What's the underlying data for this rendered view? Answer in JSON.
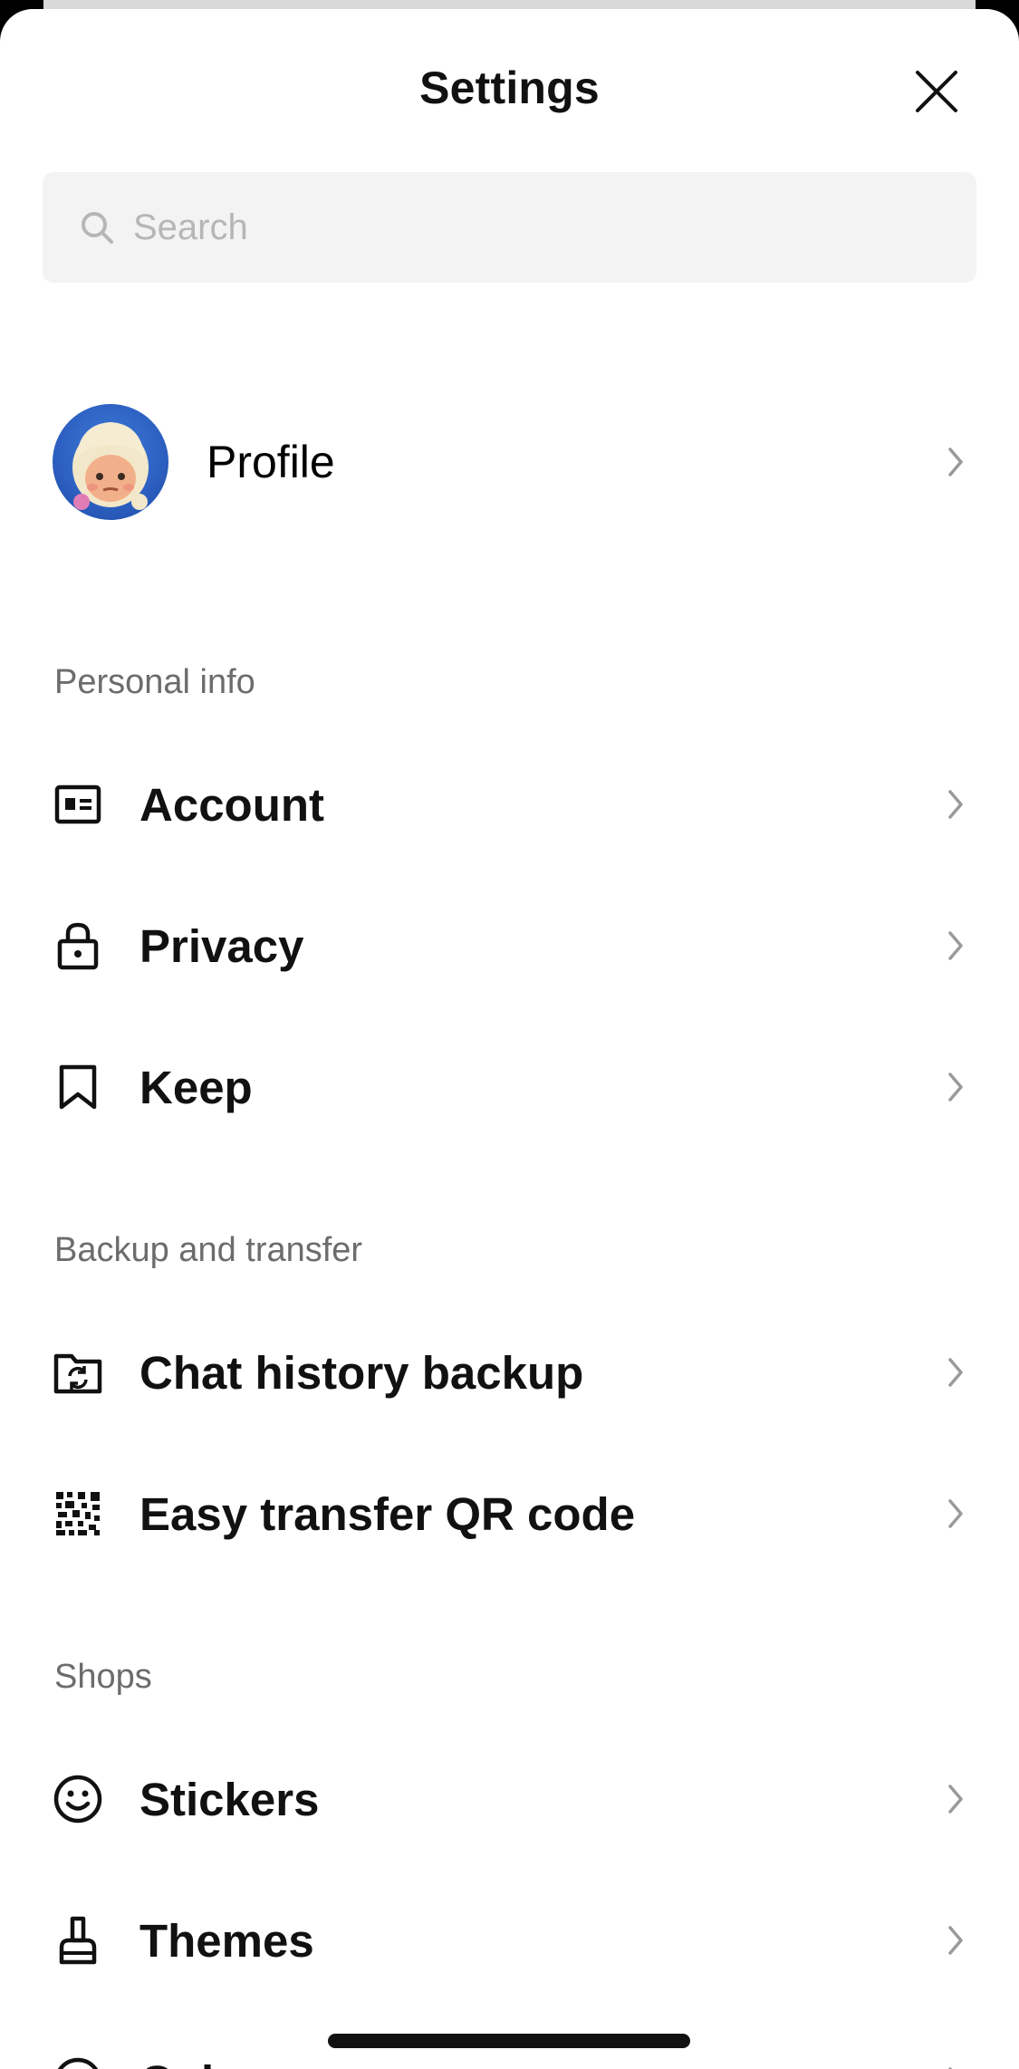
{
  "header": {
    "title": "Settings",
    "close_icon": "close-icon"
  },
  "search": {
    "placeholder": "Search",
    "value": "",
    "icon": "search-icon"
  },
  "profile": {
    "label": "Profile",
    "avatar": "avatar"
  },
  "sections": {
    "personal_info": {
      "title": "Personal info",
      "items": [
        {
          "label": "Account",
          "icon": "id-card-icon"
        },
        {
          "label": "Privacy",
          "icon": "lock-icon"
        },
        {
          "label": "Keep",
          "icon": "bookmark-icon"
        }
      ]
    },
    "backup": {
      "title": "Backup and transfer",
      "items": [
        {
          "label": "Chat history backup",
          "icon": "folder-sync-icon"
        },
        {
          "label": "Easy transfer QR code",
          "icon": "qr-code-icon"
        }
      ]
    },
    "shops": {
      "title": "Shops",
      "items": [
        {
          "label": "Stickers",
          "icon": "smiley-icon"
        },
        {
          "label": "Themes",
          "icon": "brush-icon"
        },
        {
          "label": "Coins",
          "icon": "coin-icon"
        }
      ]
    }
  },
  "colors": {
    "background": "#ffffff",
    "search_bg": "#f3f3f3",
    "section_text": "#6c6c6c",
    "chevron": "#9a9a9a"
  }
}
